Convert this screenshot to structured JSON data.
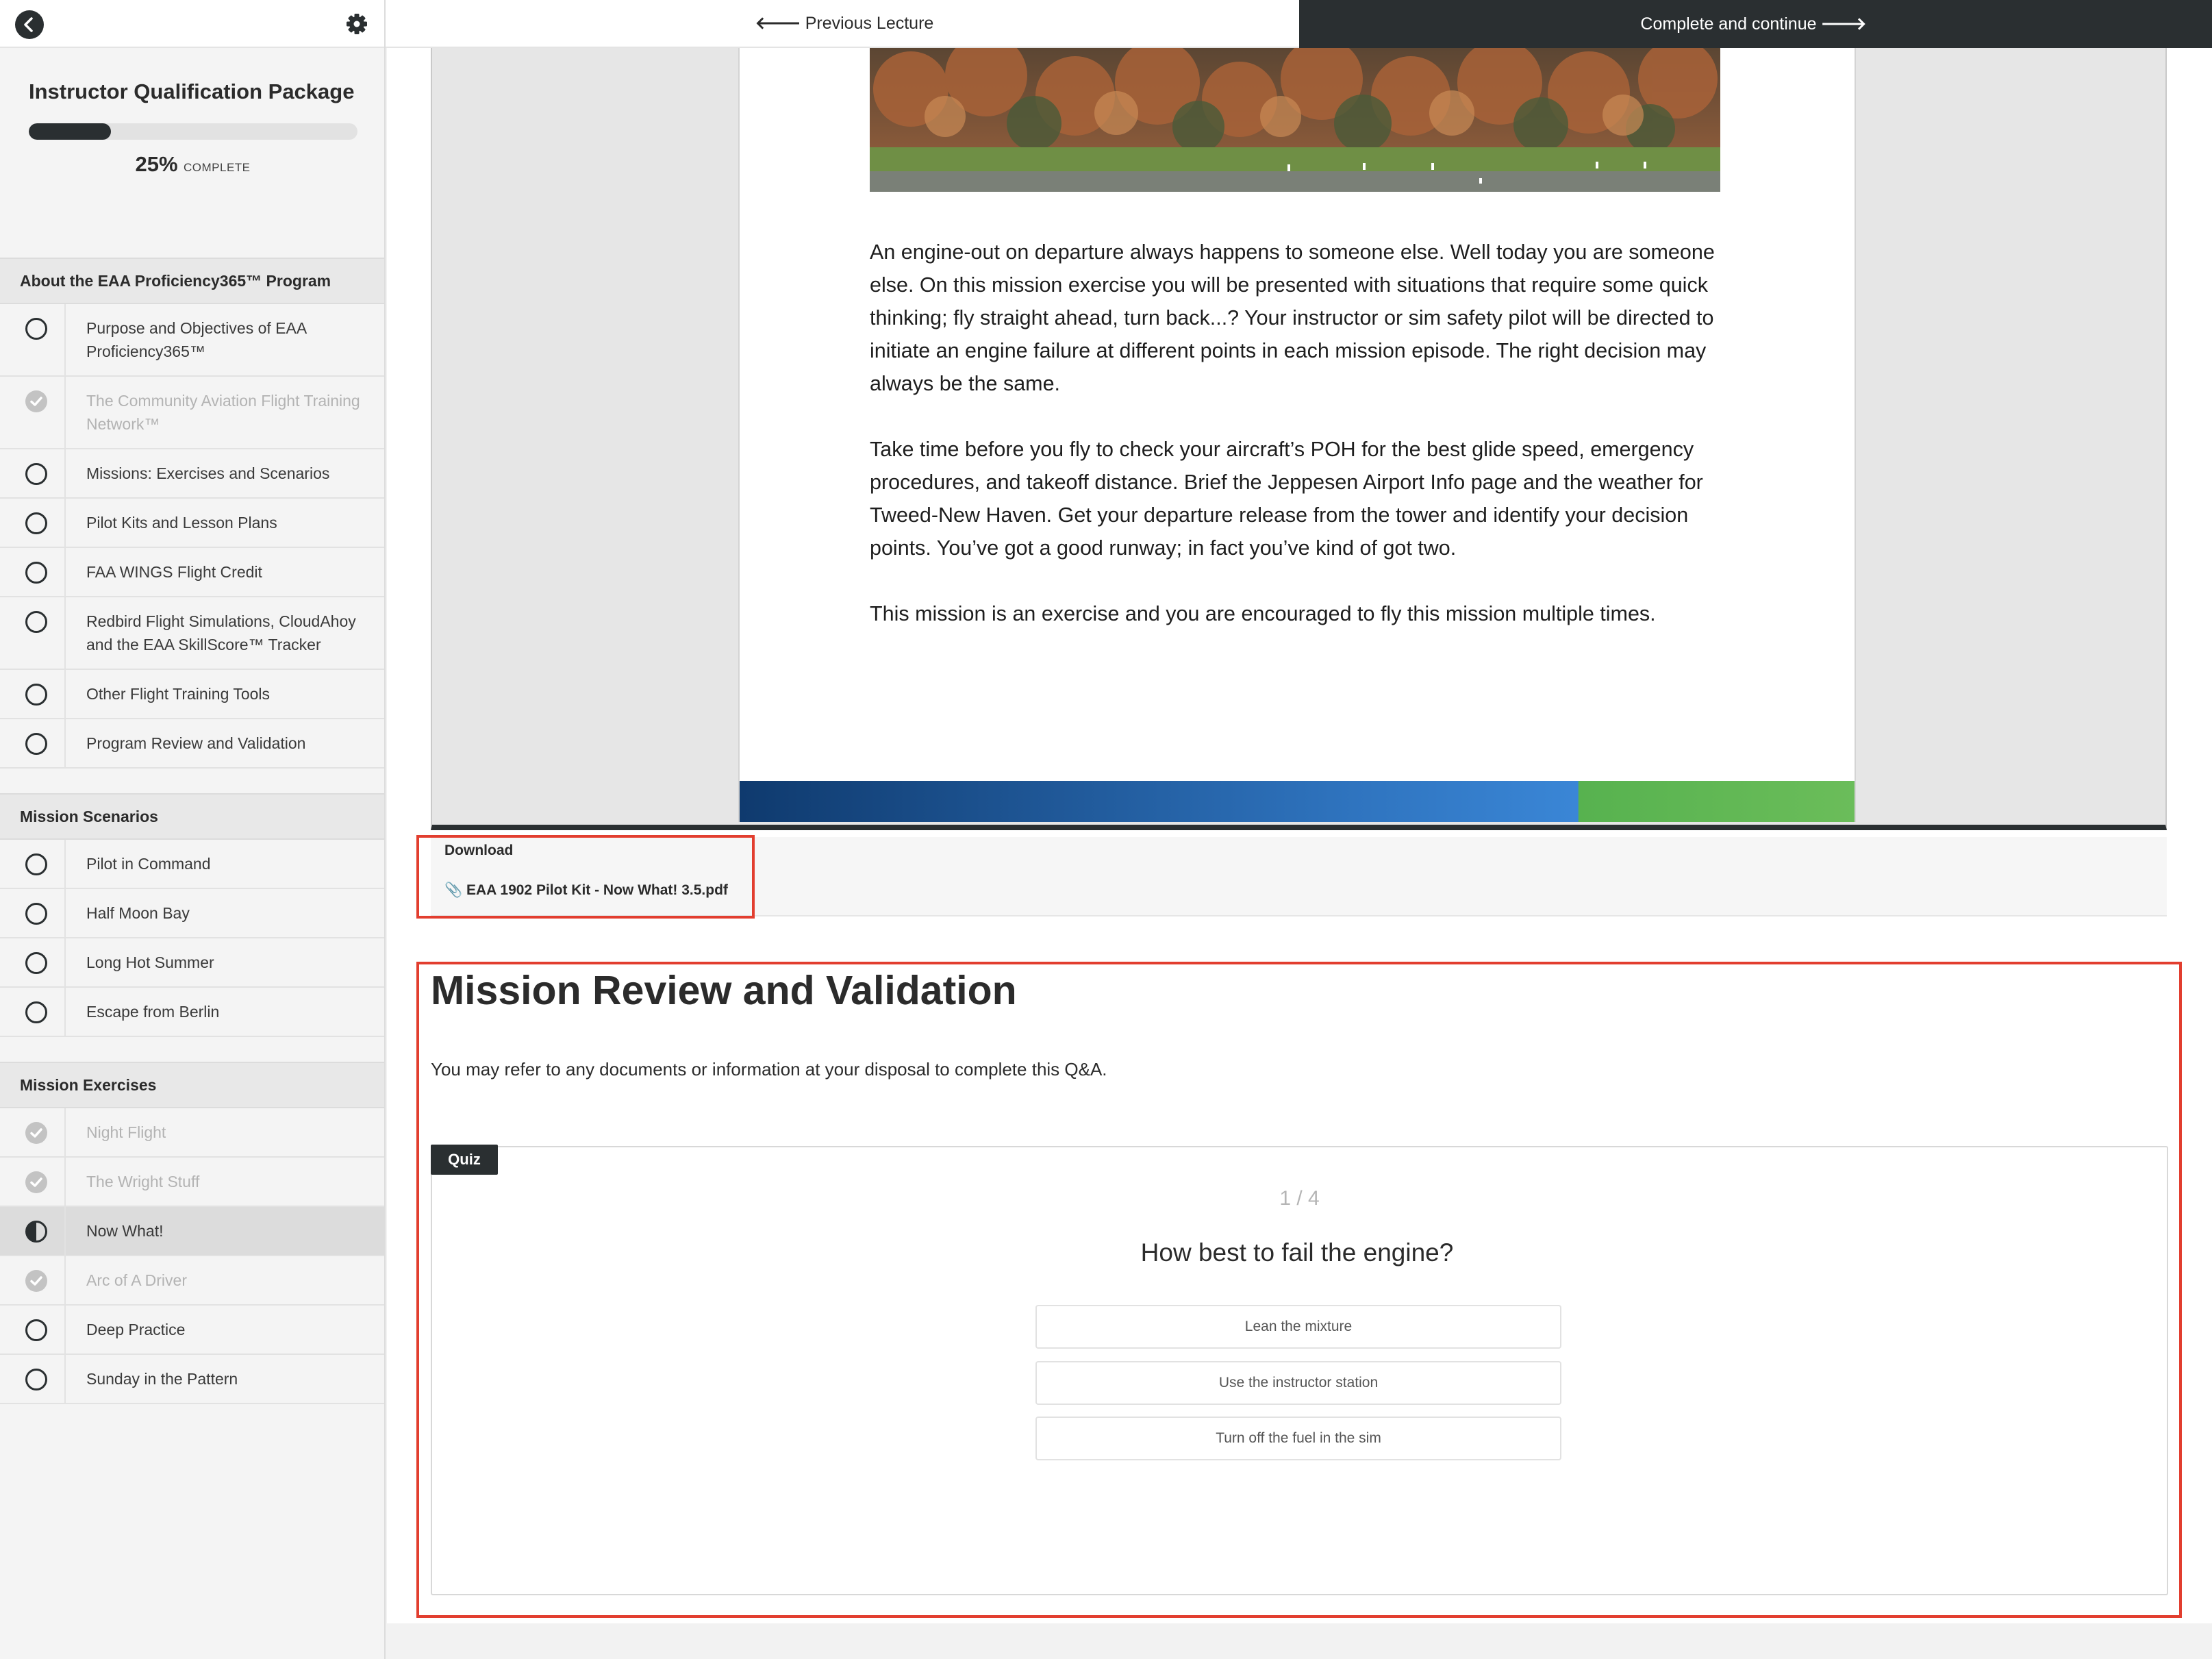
{
  "sidebar": {
    "course_title": "Instructor Qualification Package",
    "progress_pct": "25%",
    "progress_value": 25,
    "progress_word": "COMPLETE",
    "sections": [
      {
        "title": "About the EAA Proficiency365™ Program",
        "items": [
          {
            "label": "Purpose and Objectives of EAA Proficiency365™",
            "status": "incomplete"
          },
          {
            "label": "The Community Aviation Flight Training Network™",
            "status": "completed"
          },
          {
            "label": "Missions: Exercises and Scenarios",
            "status": "incomplete"
          },
          {
            "label": "Pilot Kits and Lesson Plans",
            "status": "incomplete"
          },
          {
            "label": "FAA WINGS Flight Credit",
            "status": "incomplete"
          },
          {
            "label": "Redbird Flight Simulations, CloudAhoy and the EAA SkillScore™ Tracker",
            "status": "incomplete"
          },
          {
            "label": "Other Flight Training Tools",
            "status": "incomplete"
          },
          {
            "label": "Program Review and Validation",
            "status": "incomplete"
          }
        ]
      },
      {
        "title": "Mission Scenarios",
        "items": [
          {
            "label": "Pilot in Command",
            "status": "incomplete"
          },
          {
            "label": "Half Moon Bay",
            "status": "incomplete"
          },
          {
            "label": "Long Hot Summer",
            "status": "incomplete"
          },
          {
            "label": "Escape from Berlin",
            "status": "incomplete"
          }
        ]
      },
      {
        "title": "Mission Exercises",
        "items": [
          {
            "label": "Night Flight",
            "status": "completed"
          },
          {
            "label": "The Wright Stuff",
            "status": "completed"
          },
          {
            "label": "Now What!",
            "status": "in-progress"
          },
          {
            "label": "Arc of A Driver",
            "status": "completed"
          },
          {
            "label": "Deep Practice",
            "status": "incomplete"
          },
          {
            "label": "Sunday in the Pattern",
            "status": "incomplete"
          }
        ]
      }
    ]
  },
  "topbar": {
    "prev_label": "Previous Lecture",
    "next_label": "Complete and continue"
  },
  "pdf": {
    "paragraphs": [
      "An engine-out on departure always happens to someone else. Well today you are someone else.  On this mission exercise you will be presented with situations that require some quick thinking;  fly straight ahead, turn back...?  Your instructor or sim safety pilot will be directed to initiate an engine failure at different points in each mission episode.  The right decision may always be the same.",
      "Take time before you fly to check your aircraft’s POH for the best glide speed, emergency procedures, and takeoff distance.  Brief the Jeppesen Airport Info page and the weather for Tweed-New Haven.  Get your departure release from the tower and identify your decision points.  You’ve got a good runway;  in fact you’ve kind of got two.",
      "This mission is an exercise and you are encouraged to fly this mission multiple times."
    ]
  },
  "download": {
    "label": "Download",
    "file_name": "EAA 1902 Pilot Kit - Now What! 3.5.pdf"
  },
  "quiz_section": {
    "title": "Mission Review and Validation",
    "description": "You may refer to any documents or information at your disposal to complete this Q&A.",
    "tag": "Quiz",
    "counter": "1 / 4",
    "question": "How best to fail the engine?",
    "answers": [
      "Lean the mixture",
      "Use the instructor station",
      "Turn off the fuel in the sim"
    ]
  },
  "colors": {
    "dark": "#2a2f31",
    "highlight_red": "#e23e2f",
    "completed_gray": "#c3c3c3"
  }
}
